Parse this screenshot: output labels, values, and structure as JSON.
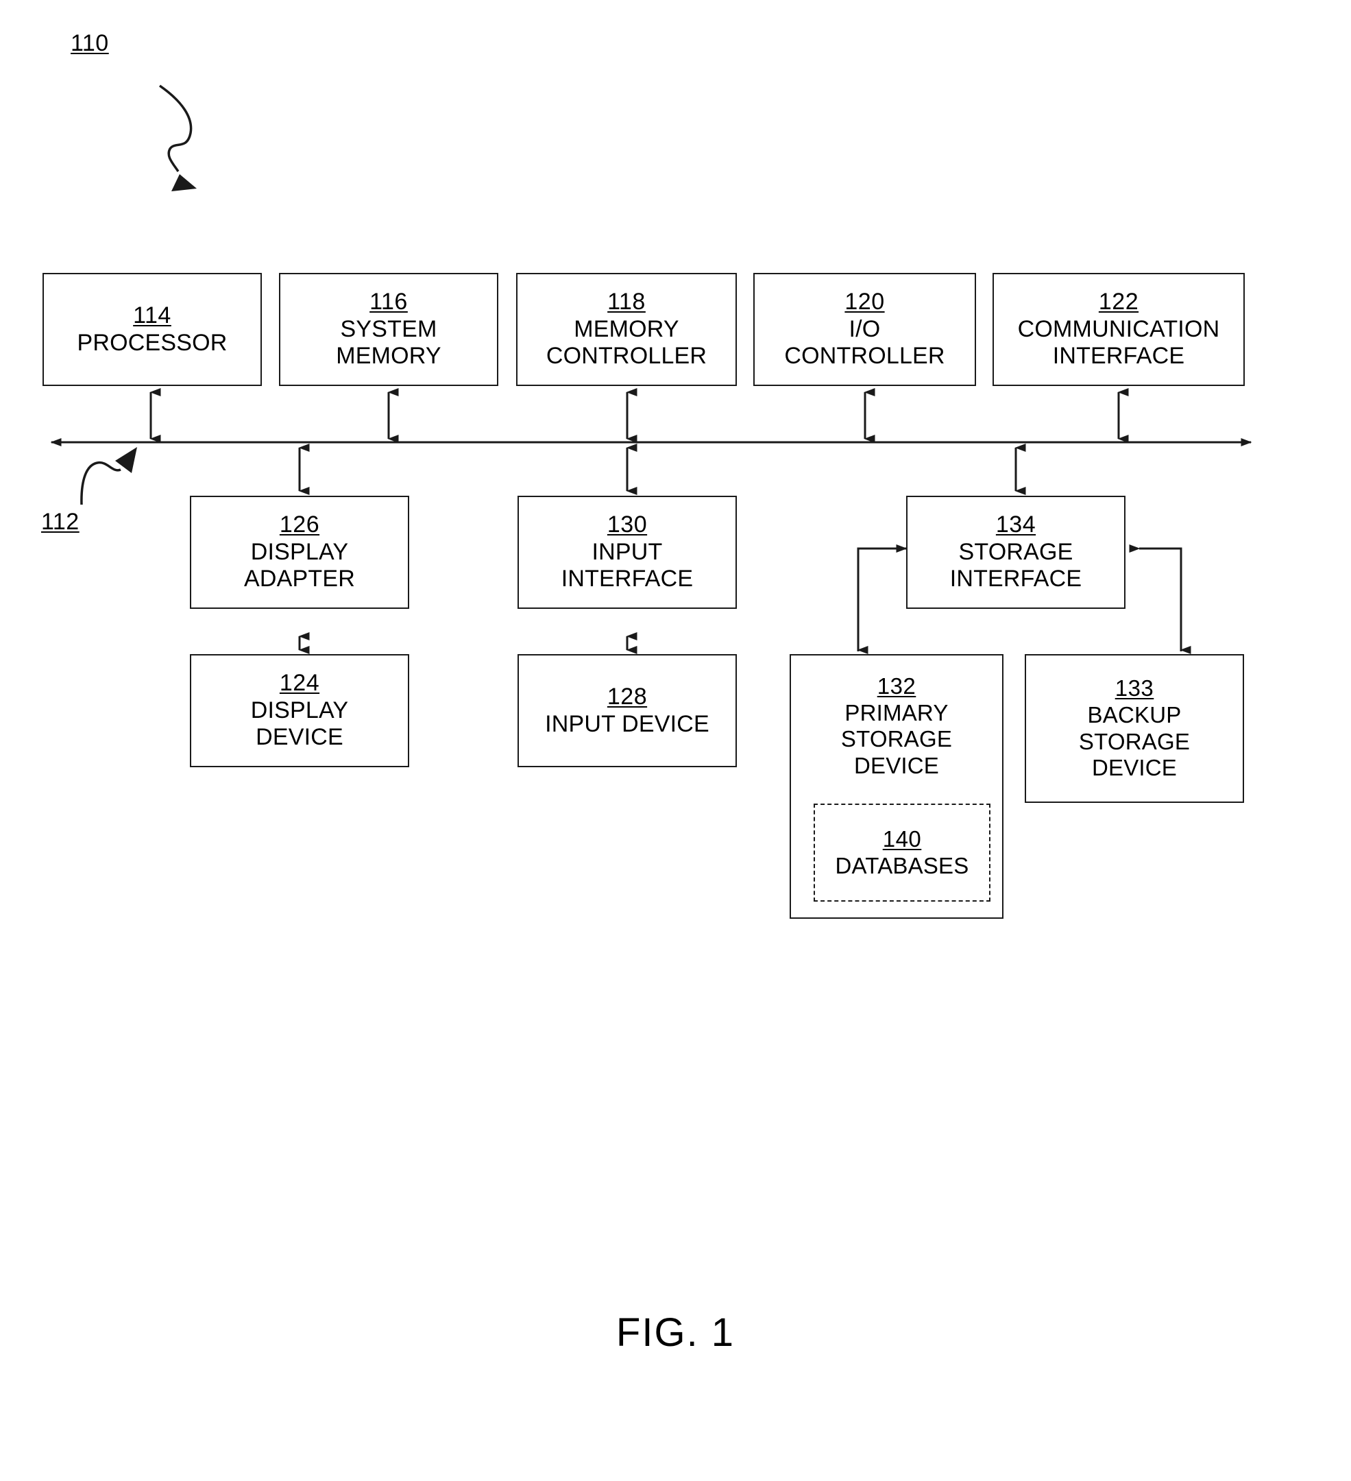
{
  "figure": {
    "caption": "FIG. 1",
    "system_ref": "110",
    "bus_ref": "112"
  },
  "blocks": {
    "processor": {
      "ref": "114",
      "label": "PROCESSOR"
    },
    "system_memory": {
      "ref": "116",
      "label": "SYSTEM\nMEMORY"
    },
    "memory_controller": {
      "ref": "118",
      "label": "MEMORY\nCONTROLLER"
    },
    "io_controller": {
      "ref": "120",
      "label": "I/O\nCONTROLLER"
    },
    "communication_interface": {
      "ref": "122",
      "label": "COMMUNICATION\nINTERFACE"
    },
    "display_adapter": {
      "ref": "126",
      "label": "DISPLAY\nADAPTER"
    },
    "input_interface": {
      "ref": "130",
      "label": "INPUT\nINTERFACE"
    },
    "storage_interface": {
      "ref": "134",
      "label": "STORAGE\nINTERFACE"
    },
    "display_device": {
      "ref": "124",
      "label": "DISPLAY\nDEVICE"
    },
    "input_device": {
      "ref": "128",
      "label": "INPUT DEVICE"
    },
    "primary_storage_device": {
      "ref": "132",
      "label": "PRIMARY\nSTORAGE\nDEVICE"
    },
    "backup_storage_device": {
      "ref": "133",
      "label": "BACKUP\nSTORAGE\nDEVICE"
    },
    "databases": {
      "ref": "140",
      "label": "DATABASES"
    }
  },
  "colors": {
    "stroke": "#1a1a1a",
    "background": "#ffffff"
  }
}
